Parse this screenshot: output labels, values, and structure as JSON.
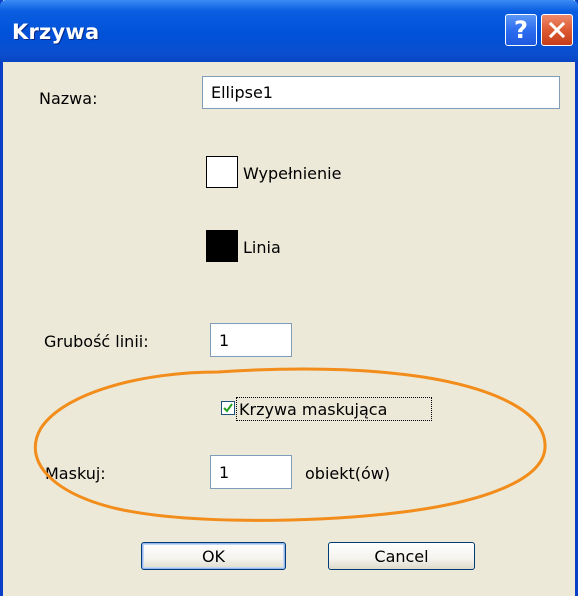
{
  "window": {
    "title": "Krzywa",
    "help_symbol": "?"
  },
  "form": {
    "name_label": "Nazwa:",
    "name_value": "Ellipse1",
    "fill_label": "Wypełnienie",
    "fill_color": "#ffffff",
    "line_label": "Linia",
    "line_color": "#000000",
    "thickness_label": "Grubość linii:",
    "thickness_value": "1",
    "mask_checkbox_label": "Krzywa maskująca",
    "mask_checked": true,
    "mask_label": "Maskuj:",
    "mask_value": "1",
    "mask_unit": "obiekt(ów)"
  },
  "buttons": {
    "ok_label": "OK",
    "cancel_label": "Cancel"
  },
  "colors": {
    "title_bar": "#0054e3",
    "dialog_bg": "#ece9d8",
    "annotation_ellipse": "#f28c1a"
  }
}
